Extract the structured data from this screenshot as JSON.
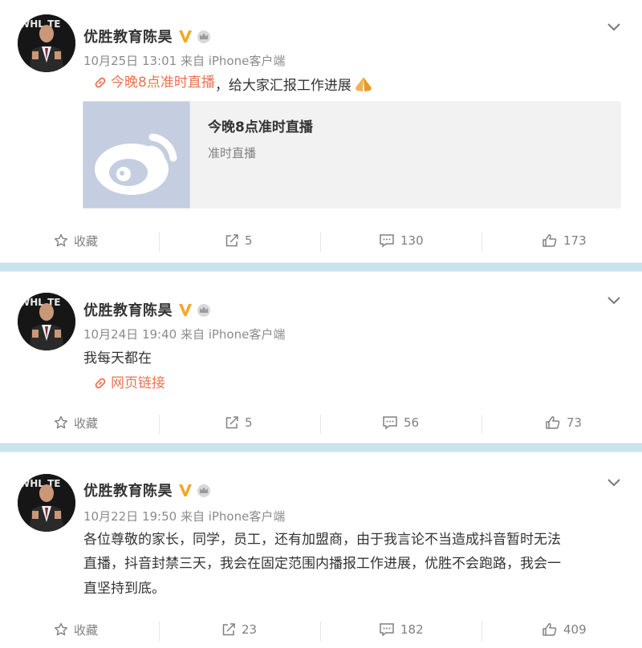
{
  "colors": {
    "link": "#eb7350",
    "verified": "#f6a623",
    "separator": "#c8e3ec"
  },
  "posts": [
    {
      "author": "优胜教育陈昊",
      "meta": "10月25日 13:01 来自 iPhone客户端",
      "link_text": "今晚8点准时直播",
      "text_after": "，给大家汇报工作进展",
      "emoji": "pray-hands-emoji",
      "card": {
        "title": "今晚8点准时直播",
        "subtitle": "准时直播",
        "thumb_icon": "weibo-logo-icon"
      },
      "actions": {
        "favorite": "收藏",
        "repost": "5",
        "comment": "130",
        "like": "173"
      }
    },
    {
      "author": "优胜教育陈昊",
      "meta": "10月24日 19:40 来自 iPhone客户端",
      "text": "我每天都在",
      "link_text": "网页链接",
      "actions": {
        "favorite": "收藏",
        "repost": "5",
        "comment": "56",
        "like": "73"
      }
    },
    {
      "author": "优胜教育陈昊",
      "meta": "10月22日 19:50 来自 iPhone客户端",
      "lines": [
        "各位尊敬的家长，同学，员工，还有加盟商，由于我言论不当造成抖音暂时无法",
        "直播，抖音封禁三天，我会在固定范围内播报工作进展，优胜不会跑路，我会一",
        "直坚持到底。"
      ],
      "actions": {
        "favorite": "收藏",
        "repost": "23",
        "comment": "182",
        "like": "409"
      }
    }
  ]
}
